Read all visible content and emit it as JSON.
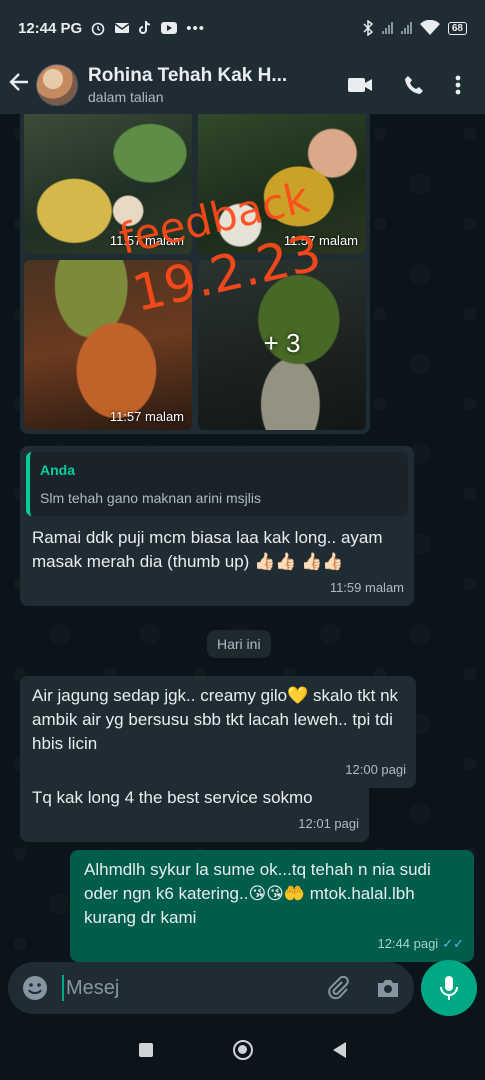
{
  "status_bar": {
    "time": "12:44 PG",
    "battery": "68"
  },
  "header": {
    "contact_name": "Rohina Tehah  Kak H...",
    "status": "dalam talian"
  },
  "media_album": {
    "timestamps": [
      "11:57 malam",
      "11:57 malam",
      "11:57 malam"
    ],
    "more_count": "+ 3",
    "watermark_line1": "feedback",
    "watermark_line2": "19.2.23"
  },
  "messages": [
    {
      "direction": "in",
      "quote_author": "Anda",
      "quote_text": "Slm tehah gano maknan arini msjlis",
      "text": "Ramai ddk puji mcm biasa laa kak long.. ayam masak merah dia (thumb up) 👍🏻👍🏻 👍🏻👍🏻",
      "time": "11:59 malam"
    },
    {
      "direction": "in",
      "text": "Air jagung sedap jgk.. creamy gilo💛 skalo tkt nk ambik air yg bersusu sbb tkt lacah leweh.. tpi tdi hbis licin",
      "time": "12:00 pagi"
    },
    {
      "direction": "in",
      "text": "Tq kak long 4 the best service sokmo",
      "time": "12:01 pagi"
    },
    {
      "direction": "out",
      "text": "Alhmdlh sykur la sume ok...tq tehah n nia sudi oder ngn k6 katering..😘😘🤲 mtok.halal.lbh kurang dr kami",
      "time": "12:44 pagi",
      "ticks": "✓✓"
    }
  ],
  "day_chip": "Hari ini",
  "composer": {
    "placeholder": "Mesej"
  },
  "colors": {
    "accent": "#00a884",
    "outgoing_bubble": "#005c4b",
    "incoming_bubble": "#202c33",
    "watermark": "#ff4a1a"
  }
}
